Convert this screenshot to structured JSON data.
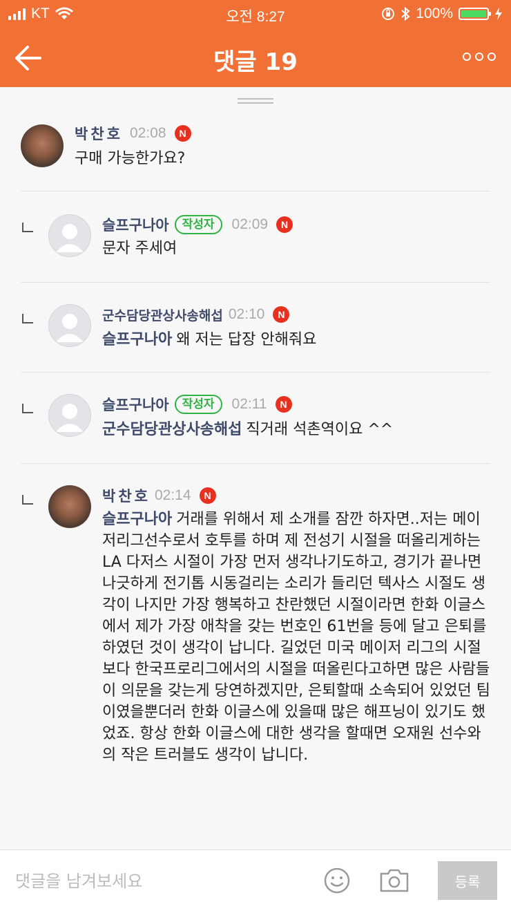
{
  "status_bar": {
    "carrier": "KT",
    "time": "오전 8:27",
    "battery": "100%",
    "battery_color": "#4cd964"
  },
  "navbar": {
    "title": "댓글 19",
    "accent": "#f07036"
  },
  "comments": [
    {
      "author": "박찬호",
      "time": "02:08",
      "new_badge": "N",
      "text": "구매 가능한가요?"
    },
    {
      "author": "슬프구나아",
      "owner_badge": "작성자",
      "time": "02:09",
      "new_badge": "N",
      "text": "문자 주세여"
    },
    {
      "author": "군수담당관상사송해섭",
      "time": "02:10",
      "new_badge": "N",
      "mention": "슬프구나아",
      "text": "왜 저는 답장 안해줘요"
    },
    {
      "author": "슬프구나아",
      "owner_badge": "작성자",
      "time": "02:11",
      "new_badge": "N",
      "mention": "군수담당관상사송해섭",
      "text": "직거래 석촌역이요 ^^"
    },
    {
      "author": "박찬호",
      "time": "02:14",
      "new_badge": "N",
      "mention": "슬프구나아",
      "text": "거래를 위해서 제 소개를 잠깐 하자면..저는 메이저리그선수로서 호투를 하며 제 전성기 시절을 떠올리게하는 LA 다저스 시절이 가장 먼저 생각나기도하고, 경기가 끝나면 나긋하게 전기톱 시동걸리는 소리가 들리던 텍사스 시절도 생각이 나지만 가장 행복하고 찬란했던 시절이라면 한화 이글스에서 제가 가장 애착을 갖는 번호인 61번을 등에 달고 은퇴를 하였던 것이 생각이 납니다. 길었던 미국 메이저 리그의 시절보다 한국프로리그에서의 시절을 떠올린다고하면 많은 사람들이 의문을 갖는게 당연하겠지만, 은퇴할때 소속되어 있었던 팀이였을뿐더러 한화 이글스에 있을때 많은 해프닝이 있기도 했었죠. 항상 한화 이글스에 대한 생각을 할때면 오재원 선수와의 작은 트러블도 생각이 납니다."
    }
  ],
  "input_bar": {
    "placeholder": "댓글을 남겨보세요",
    "submit_label": "등록"
  }
}
